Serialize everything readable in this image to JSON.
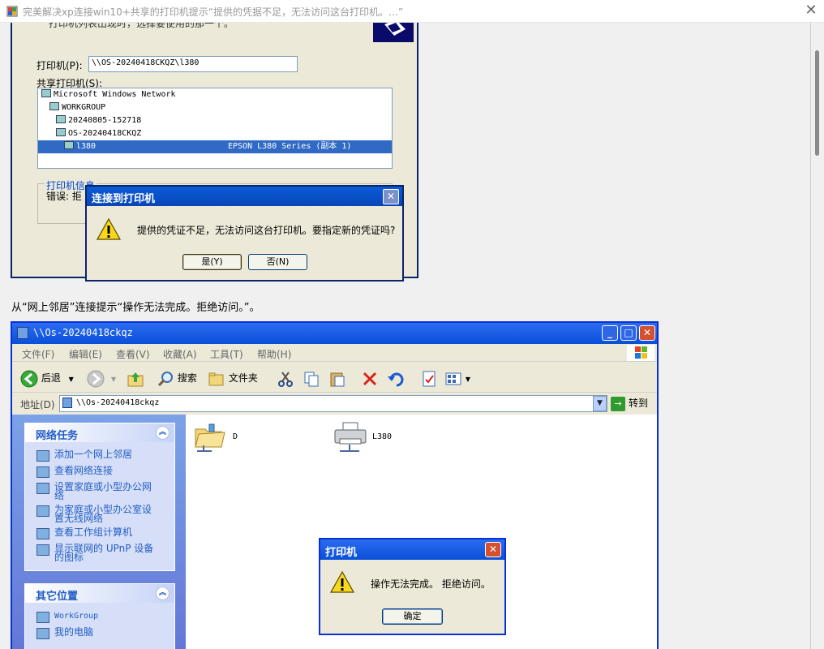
{
  "window": {
    "title": "完美解决xp连接win10+共享的打印机提示“提供的凭据不足，无法访问这台打印机。…”",
    "close_glyph": "✕"
  },
  "shot1": {
    "top_text": "打印机列表出现时，选择要使用的那一个。",
    "printer_label": "打印机(P):",
    "printer_value": "\\\\OS-20240418CKQZ\\l380",
    "shared_label": "共享打印机(S):",
    "tree": [
      {
        "text": "Microsoft Windows Network",
        "detail": "",
        "indent": 0
      },
      {
        "text": "WORKGROUP",
        "detail": "",
        "indent": 1
      },
      {
        "text": "20240805-152718",
        "detail": "",
        "indent": 2
      },
      {
        "text": "OS-20240418CKQZ",
        "detail": "",
        "indent": 2
      },
      {
        "text": "l380",
        "detail": "EPSON L380 Series (副本 1)",
        "indent": 3,
        "selected": true
      }
    ],
    "info_legend": "打印机信息",
    "info_error": "错误: 拒"
  },
  "dialog1": {
    "title": "连接到打印机",
    "close_glyph": "✕",
    "message": "提供的凭证不足，无法访问这台打印机。要指定新的凭证吗?",
    "yes_label": "是(Y)",
    "no_label": "否(N)"
  },
  "caption": "从“网上邻居”连接提示“操作无法完成。拒绝访问。”。",
  "explorer": {
    "title": "\\\\Os-20240418ckqz",
    "min_glyph": "_",
    "max_glyph": "□",
    "close_glyph": "✕",
    "menu": [
      "文件(F)",
      "编辑(E)",
      "查看(V)",
      "收藏(A)",
      "工具(T)",
      "帮助(H)"
    ],
    "toolbar": {
      "back": "后退",
      "search": "搜索",
      "folders": "文件夹"
    },
    "address_label": "地址(D)",
    "address_value": "\\\\Os-20240418ckqz",
    "dropdown_glyph": "▼",
    "goto_arrow": "→",
    "goto_label": "转到",
    "network_tasks_title": "网络任务",
    "network_tasks": [
      "添加一个网上邻居",
      "查看网络连接",
      "设置家庭或小型办公网络",
      "为家庭或小型办公室设置无线网络",
      "查看工作组计算机",
      "显示联网的 UPnP 设备的图标"
    ],
    "other_places_title": "其它位置",
    "other_places": [
      "WorkGroup",
      "我的电脑"
    ],
    "chevron_glyph": "︽",
    "items": [
      {
        "label": "D",
        "icon": "shared-folder-icon"
      },
      {
        "label": "L380",
        "icon": "printer-icon"
      }
    ]
  },
  "dialog2": {
    "title": "打印机",
    "close_glyph": "✕",
    "message": "操作无法完成。 拒绝访问。",
    "ok_label": "确定"
  }
}
